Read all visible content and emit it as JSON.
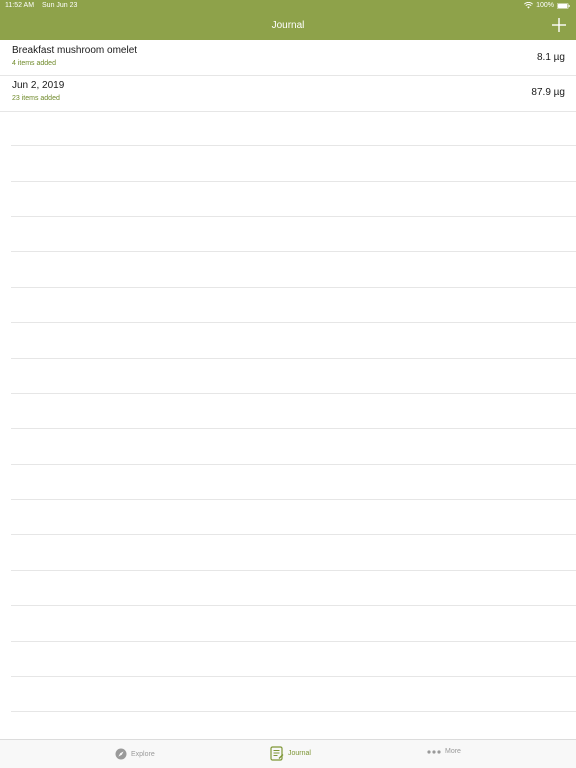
{
  "status_bar": {
    "time": "11:52 AM",
    "date": "Sun Jun 23",
    "battery": "100%"
  },
  "nav": {
    "title": "Journal",
    "add_icon": "plus-icon"
  },
  "entries": [
    {
      "title": "Breakfast mushroom omelet",
      "subtitle": "4 items added",
      "value": "8.1 µg"
    },
    {
      "title": "Jun 2, 2019",
      "subtitle": "23 items added",
      "value": "87.9 µg"
    }
  ],
  "tabs": [
    {
      "label": "Explore",
      "icon": "compass-icon",
      "active": false
    },
    {
      "label": "Journal",
      "icon": "journal-icon",
      "active": true
    },
    {
      "label": "More",
      "icon": "more-dots-icon",
      "active": false
    }
  ],
  "colors": {
    "accent": "#8ea24a",
    "subtitle": "#6f8a2a",
    "inactive_tab": "#9a9a9a"
  }
}
